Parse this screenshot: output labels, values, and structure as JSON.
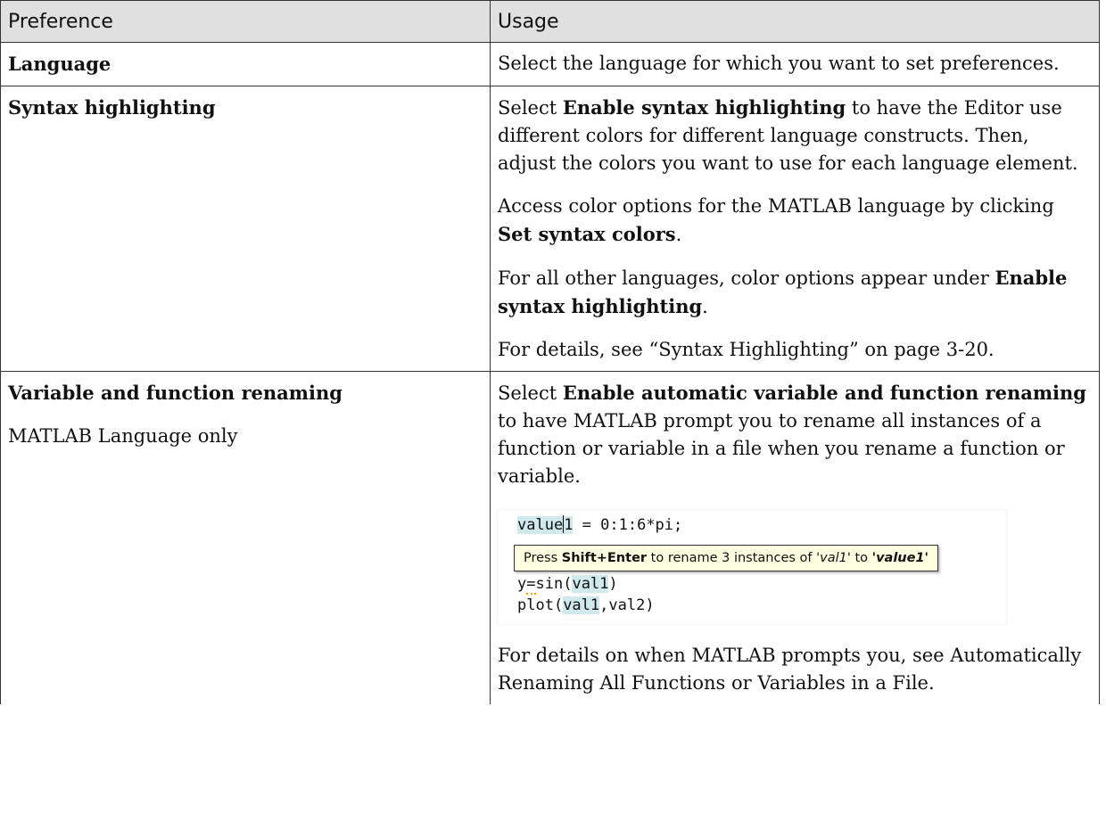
{
  "table": {
    "headers": {
      "preference": "Preference",
      "usage": "Usage"
    },
    "rows": {
      "language": {
        "name": "Language",
        "usage_text": "Select the language for which you want to set preferences."
      },
      "syntax": {
        "name": "Syntax highlighting",
        "p1_pre": "Select ",
        "p1_bold": "Enable syntax highlighting",
        "p1_post": " to have the Editor use different colors for different language constructs. Then, adjust the colors you want to use for each language element.",
        "p2_pre": "Access color options for the MATLAB language by clicking ",
        "p2_bold": "Set syntax colors",
        "p2_post": ".",
        "p3_pre": "For all other languages, color options appear under ",
        "p3_bold": "Enable syntax highlighting",
        "p3_post": ".",
        "p4": "For details, see “Syntax Highlighting” on page 3-20."
      },
      "renaming": {
        "name": "Variable and function renaming",
        "note": "MATLAB Language only",
        "p1_pre": "Select ",
        "p1_bold": "Enable automatic variable and function renaming",
        "p1_post": " to have MATLAB prompt you to rename all instances of a function or variable in a file when you rename a function or variable.",
        "p2": "For details on when MATLAB prompts you, see Automatically Renaming All Functions or Variables in a File."
      }
    }
  },
  "screenshot": {
    "line1_var_a": "value",
    "line1_var_b": "1",
    "line1_rest": " = 0:1:6*pi;",
    "line3_a": "y",
    "line3_b": "=",
    "line3_c": "sin(",
    "line3_var": "val1",
    "line3_d": ")",
    "line4_a": "plot(",
    "line4_var": "val1",
    "line4_b": ",val2)",
    "tooltip": {
      "t1": "Press ",
      "t2": "Shift+Enter",
      "t3": " to rename 3 instances of ",
      "t4": "'val1'",
      "t5": " to ",
      "t6": "'value1'"
    },
    "highlight_color": "#cfe9ec",
    "tooltip_bg": "#ffffe1"
  }
}
